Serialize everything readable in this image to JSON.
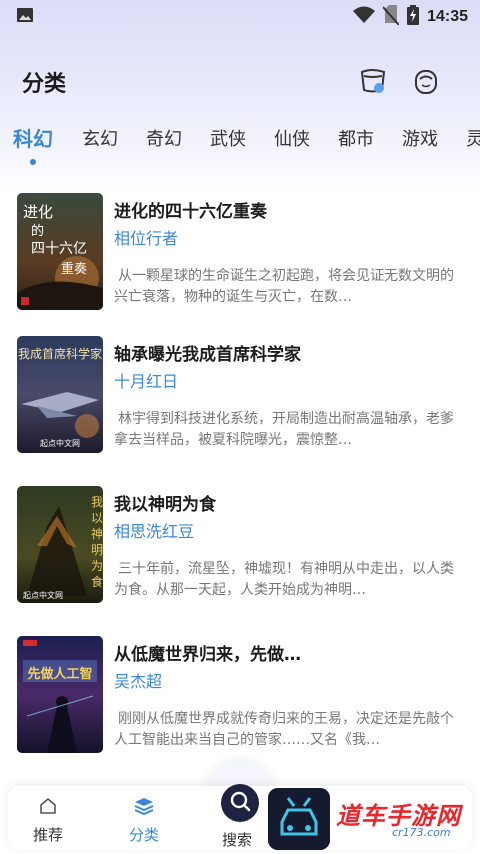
{
  "status_bar": {
    "time": "14:35",
    "icons": [
      "image-icon",
      "wifi-icon",
      "no-sim-icon",
      "battery-charging-icon"
    ]
  },
  "header": {
    "title": "分类",
    "icons": [
      "bookshelf-icon",
      "customer-service-icon"
    ]
  },
  "tabs": [
    {
      "label": "科幻",
      "active": true
    },
    {
      "label": "玄幻",
      "active": false
    },
    {
      "label": "奇幻",
      "active": false
    },
    {
      "label": "武侠",
      "active": false
    },
    {
      "label": "仙侠",
      "active": false
    },
    {
      "label": "都市",
      "active": false
    },
    {
      "label": "游戏",
      "active": false
    },
    {
      "label": "灵",
      "active": false
    }
  ],
  "books": [
    {
      "title": "进化的四十六亿重奏",
      "author": "相位行者",
      "description": "从一颗星球的生命诞生之初起跑，将会见证无数文明的兴亡衰落，物种的诞生与灭亡，在数…",
      "cover_text": "进化的四十六亿重奏",
      "cover_author": "相位行者"
    },
    {
      "title": "轴承曝光我成首席科学家",
      "author": "十月红日",
      "description": "林宇得到科技进化系统，开局制造出耐高温轴承，老爹拿去当样品，被夏科院曝光，震惊整…",
      "cover_text": "我成首席科学家",
      "cover_author": "起点中文网"
    },
    {
      "title": "我以神明为食",
      "author": "相思洗红豆",
      "description": "三十年前，流星坠，神墟现！有神明从中走出，以人类为食。从那一天起，人类开始成为神明…",
      "cover_text": "我以神明为食",
      "cover_author": "起点中文网"
    },
    {
      "title": "从低魔世界归来，先做…",
      "author": "吴杰超",
      "description": "刚刚从低魔世界成就传奇归来的王易，决定还是先敲个人工智能出来当自己的管家……又名《我…",
      "cover_text": "先做个人工智能",
      "cover_author": "吴杰超"
    }
  ],
  "bottom_nav": {
    "items": [
      {
        "label": "推荐",
        "icon": "home-icon",
        "active": false
      },
      {
        "label": "分类",
        "icon": "layers-icon",
        "active": true
      },
      {
        "label": "搜索",
        "icon": "search-icon",
        "active": false
      }
    ]
  },
  "watermark": {
    "text": "道车手游网",
    "sub": "cr173.com"
  },
  "colors": {
    "accent": "#3a87d6",
    "title": "#1b1b1b",
    "desc": "#777777"
  }
}
